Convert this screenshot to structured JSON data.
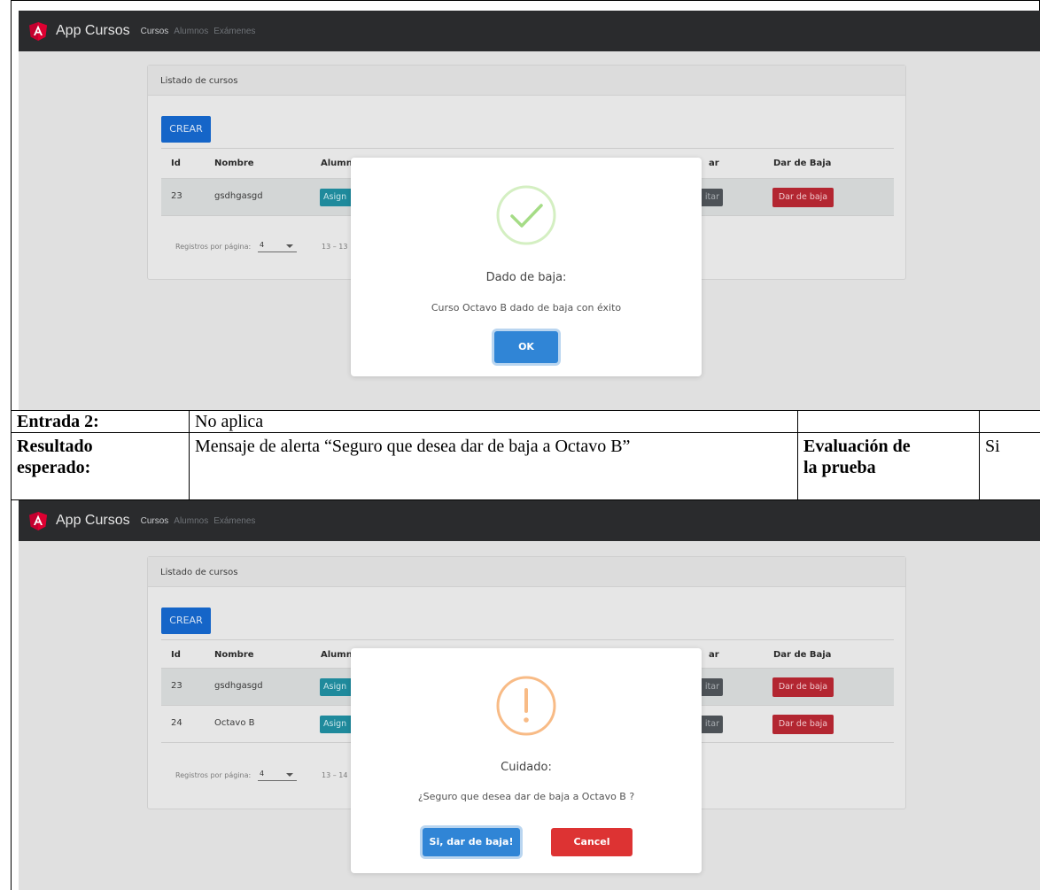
{
  "app": {
    "brand": "App Cursos",
    "nav": [
      "Cursos",
      "Alumnos",
      "Exámenes"
    ]
  },
  "screen1": {
    "card_title": "Listado de cursos",
    "crear_label": "CREAR",
    "columns": [
      "Id",
      "Nombre",
      "Alumnc",
      "ar",
      "Dar de Baja"
    ],
    "rows": [
      {
        "id": "23",
        "nombre": "gsdhgasgd",
        "asignar": "Asign",
        "editar": "itar",
        "baja": "Dar de baja"
      }
    ],
    "pager_label": "Registros por página:",
    "pager_value": "4",
    "pager_range": "13 – 13",
    "modal": {
      "icon": "success-check-icon",
      "title": "Dado de baja:",
      "text": "Curso Octavo B dado de baja con éxito",
      "ok_label": "OK"
    }
  },
  "doc_table": {
    "entrada_label": "Entrada 2:",
    "entrada_value": "No aplica",
    "resultado_label_1": "Resultado",
    "resultado_label_2": "esperado:",
    "resultado_value": "Mensaje de alerta “Seguro que desea dar de baja a Octavo B”",
    "evaluacion_label_1": "Evaluación de",
    "evaluacion_label_2": "la prueba",
    "evaluacion_value": "Si"
  },
  "screen2": {
    "card_title": "Listado de cursos",
    "crear_label": "CREAR",
    "columns": [
      "Id",
      "Nombre",
      "Alumnc",
      "ar",
      "Dar de Baja"
    ],
    "rows": [
      {
        "id": "23",
        "nombre": "gsdhgasgd",
        "asignar": "Asign",
        "editar": "itar",
        "baja": "Dar de baja"
      },
      {
        "id": "24",
        "nombre": "Octavo B",
        "asignar": "Asign",
        "editar": "itar",
        "baja": "Dar de baja"
      }
    ],
    "pager_label": "Registros por página:",
    "pager_value": "4",
    "pager_range": "13 – 14",
    "modal": {
      "icon": "warning-exclamation-icon",
      "title": "Cuidado:",
      "text": "¿Seguro que desea dar de baja a Octavo B ?",
      "confirm_label": "Si, dar de baja!",
      "cancel_label": "Cancel"
    }
  },
  "colors": {
    "navbar": "#2a2b2d",
    "primary": "#1565c8",
    "danger": "#b32631",
    "info": "#1f8a9c",
    "swal_confirm": "#3085d6",
    "swal_cancel": "#dd3333",
    "success": "#a5dc86",
    "warning": "#f8bb86"
  }
}
